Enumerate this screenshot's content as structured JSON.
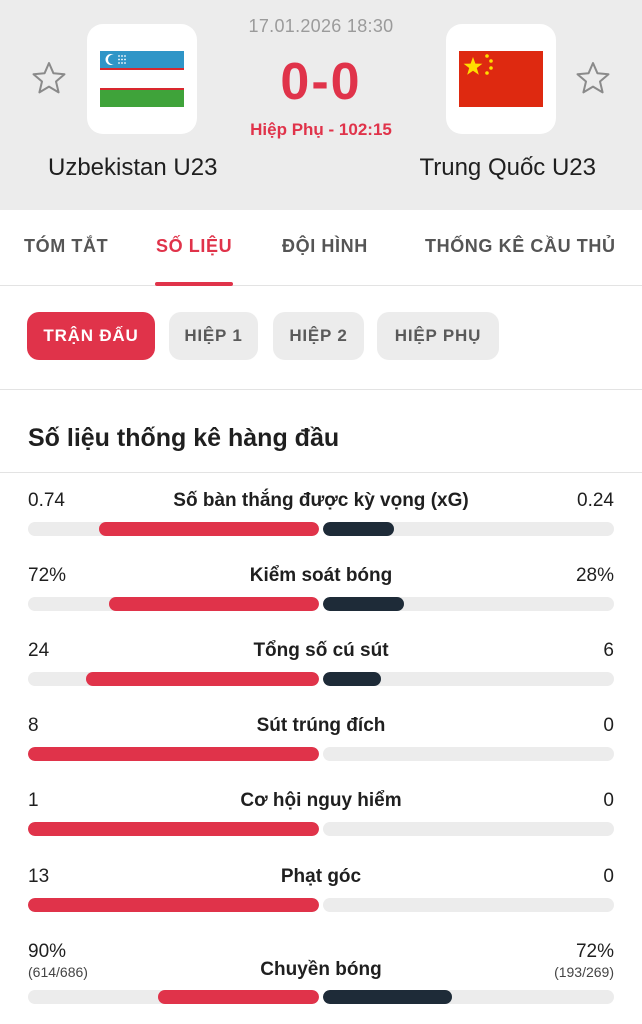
{
  "match": {
    "datetime": "17.01.2026 18:30",
    "score": "0-0",
    "status": "Hiệp Phụ - 102:15",
    "home_team": "Uzbekistan U23",
    "away_team": "Trung Quốc U23",
    "home_flag": "uzbekistan-flag",
    "away_flag": "china-flag"
  },
  "tabs": [
    {
      "label": "TÓM TẮT",
      "active": false
    },
    {
      "label": "SỐ LIỆU",
      "active": true
    },
    {
      "label": "ĐỘI HÌNH",
      "active": false
    },
    {
      "label": "THỐNG KÊ CẦU THỦ",
      "active": false
    }
  ],
  "period_tabs": [
    {
      "label": "TRẬN ĐẤU",
      "active": true
    },
    {
      "label": "HIỆP 1",
      "active": false
    },
    {
      "label": "HIỆP 2",
      "active": false
    },
    {
      "label": "HIỆP PHỤ",
      "active": false
    }
  ],
  "section_title": "Số liệu thống kê hàng đầu",
  "stats": [
    {
      "label": "Số bàn thắng được kỳ vọng (xG)",
      "home": "0.74",
      "away": "0.24",
      "home_sub": "",
      "away_sub": "",
      "home_ratio": 0.755,
      "away_ratio": 0.245
    },
    {
      "label": "Kiểm soát bóng",
      "home": "72%",
      "away": "28%",
      "home_sub": "",
      "away_sub": "",
      "home_ratio": 0.72,
      "away_ratio": 0.28
    },
    {
      "label": "Tổng số cú sút",
      "home": "24",
      "away": "6",
      "home_sub": "",
      "away_sub": "",
      "home_ratio": 0.8,
      "away_ratio": 0.2
    },
    {
      "label": "Sút trúng đích",
      "home": "8",
      "away": "0",
      "home_sub": "",
      "away_sub": "",
      "home_ratio": 1.0,
      "away_ratio": 0.0
    },
    {
      "label": "Cơ hội nguy hiểm",
      "home": "1",
      "away": "0",
      "home_sub": "",
      "away_sub": "",
      "home_ratio": 1.0,
      "away_ratio": 0.0
    },
    {
      "label": "Phạt góc",
      "home": "13",
      "away": "0",
      "home_sub": "",
      "away_sub": "",
      "home_ratio": 1.0,
      "away_ratio": 0.0
    },
    {
      "label": "Chuyền bóng",
      "home": "90%",
      "away": "72%",
      "home_sub": "(614/686)",
      "away_sub": "(193/269)",
      "home_ratio": 0.555,
      "away_ratio": 0.445
    }
  ],
  "colors": {
    "accent": "#e0334a",
    "away_bar": "#1e2b38",
    "track": "#ececec"
  }
}
